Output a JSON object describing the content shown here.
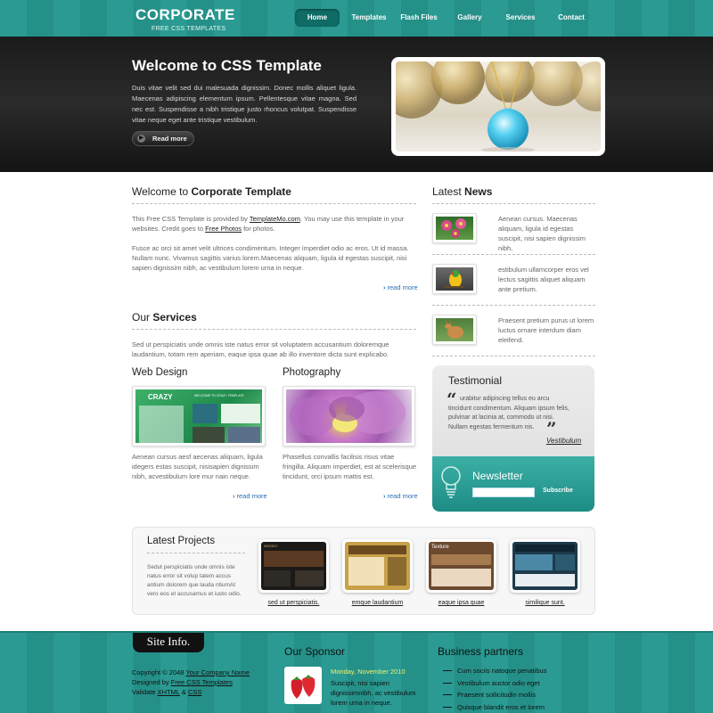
{
  "header": {
    "logo": "CORPORATE",
    "logo_sub": "FREE CSS TEMPLATES",
    "nav": [
      {
        "label": "Home",
        "active": true
      },
      {
        "label": "Templates"
      },
      {
        "label": "Flash Files"
      },
      {
        "label": "Gallery"
      },
      {
        "label": "Services"
      },
      {
        "label": "Contact"
      }
    ]
  },
  "banner": {
    "title": "Welcome to CSS Template",
    "text": "Duis vitae velit sed dui malesuada dignissim. Donec mollis aliquet ligula. Maecenas adipiscing elementum ipsum. Pellentesque vitae magna. Sed nec est. Suspendisse a nibh tristique justo rhoncus volutpat. Suspendisse vitae neque eget ante tristique vestibulum.",
    "button": "Read more"
  },
  "welcome": {
    "title_prefix": "Welcome to",
    "title_bold": "Corporate Template",
    "p1_a": "This Free CSS Template is provided by",
    "p1_link1": "TemplateMo.com",
    "p1_b": ". You may use this template in your websites. Credit goes to",
    "p1_link2": "Free Photos",
    "p1_c": "for photos.",
    "p2": "Fusce ac orci sit amet velit ultrices condimentum. Integer imperdiet odio ac eros. Ut id massa. Nullam nunc. Vivamus sagittis varius lorem.Maecenas aliquam, ligula id egestas suscipit, nisi sapien dignissim nibh, ac vestibulum lorem urna in neque.",
    "read_more": "read more"
  },
  "services": {
    "title_prefix": "Our",
    "title_bold": "Services",
    "text": "Sed ut perspiciatis unde omnis iste natus error sit voluptatem accusantium doloremque laudantium, totam rem aperiam, eaque ipsa quae ab illo inventore dicta sunt explicabo.",
    "web_design": {
      "title": "Web Design",
      "thumb_brand": "CRAZY",
      "thumb_heading": "WELCOME TO CRAZY TEMPLATE",
      "text": "Aenean cursus aesf aecenas aliquam, ligula idegers estas suscipit, nisisapien dignissim nibh, acvestibulum lore mur nain neque.",
      "read_more": "read more"
    },
    "photography": {
      "title": "Photography",
      "text": "Phasellus convallis facilisis risus vitae fringilla. Aliquam imperdiet, est at scelerisque tincidunt, orci ipsum mattis est.",
      "read_more": "read more"
    }
  },
  "news": {
    "title_prefix": "Latest",
    "title_bold": "News",
    "items": [
      {
        "text": "Aenean cursus. Maecenas aliquam, ligula id egestas suscipit, nisi sapien dignissim nibh,"
      },
      {
        "text": "estibulum ullamcorper eros vel lectus sagittis aliquet aliquam ante pretium."
      },
      {
        "text": "Praesent pretium purus ut lorem luctus ornare interdum diam eleifend."
      }
    ]
  },
  "testimonial": {
    "title": "Testimonial",
    "text": "urabitur adipiscing tellus eu arcu tincidunt condimentum. Aliquam ipsum felis, pulvinar at lacinia at, commodo ut nisi. Nullam egestas fermentum nis.",
    "author": "Vestibulum"
  },
  "newsletter": {
    "title": "Newsletter",
    "button": "Subscribe"
  },
  "projects": {
    "title": "Latest Projects",
    "text": "Sedut perspiciatis unde omnis iste natus error sit volup tatem accus antium dolorem que lauda ntiumAt vero eos et accusamus et iusto odio.",
    "items": [
      {
        "label": "sed ut perspiciatis.",
        "thumb_text": "WOODY"
      },
      {
        "label": "emque laudantium",
        "thumb_text": ""
      },
      {
        "label": "eaque ipsa quae",
        "thumb_text": "Texture"
      },
      {
        "label": "similique sunt.",
        "thumb_text": ""
      }
    ]
  },
  "footer": {
    "site_info": "Site Info.",
    "copyright_a": "Copyright © 2048",
    "company": "Your Company Name",
    "designed_a": "Designed by",
    "designer": "Free CSS Templates",
    "validate_a": "Validate",
    "xhtml": "XHTML",
    "amp": "&",
    "css": "CSS",
    "sponsor_title": "Our Sponsor",
    "sponsor_date": "Monday, November 2010",
    "sponsor_text": "Suscipit, nisi sapien dignissimnibh, ac vestibulum lorem urna in neque.",
    "partners_title": "Business partners",
    "partners": [
      "Cum sociis natoque penatibus",
      "Vestibulum auctor odio eget",
      "Praesent sollicitudin mollis",
      "Quisque blandit eros et lorem"
    ]
  },
  "colors": {
    "teal": "#2a9a92",
    "teal_dark": "#0e6b66",
    "banner_dark": "#1b1b1b",
    "link_blue": "#2a6fb0",
    "sponsor_date": "#f2f26a"
  }
}
